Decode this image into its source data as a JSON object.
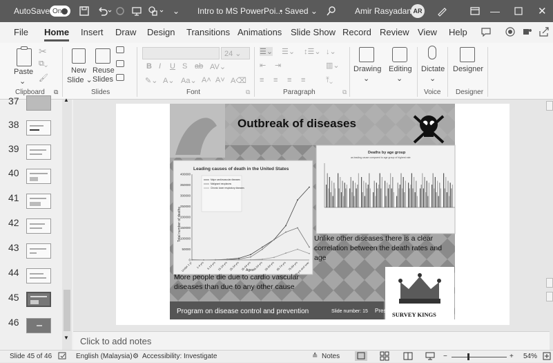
{
  "titlebar": {
    "autosave_label": "AutoSave",
    "autosave_state": "On",
    "doc_title": "Intro to MS PowerPoi...",
    "saved_status": "• Saved",
    "user_name": "Amir Rasyadan",
    "user_initials": "AR"
  },
  "menu": {
    "tabs": [
      "File",
      "Home",
      "Insert",
      "Draw",
      "Design",
      "Transitions",
      "Animations",
      "Slide Show",
      "Record",
      "Review",
      "View",
      "Help"
    ],
    "active": "Home"
  },
  "ribbon": {
    "paste": "Paste",
    "clipboard": "Clipboard",
    "new_slide_1": "New",
    "new_slide_2": "Slide",
    "reuse_1": "Reuse",
    "reuse_2": "Slides",
    "slides": "Slides",
    "font_size": "24",
    "font": "Font",
    "paragraph": "Paragraph",
    "drawing": "Drawing",
    "editing": "Editing",
    "dictate": "Dictate",
    "voice": "Voice",
    "designer_btn": "Designer",
    "designer_group": "Designer"
  },
  "thumbnails": {
    "numbers": [
      "37",
      "38",
      "39",
      "40",
      "41",
      "42",
      "43",
      "44",
      "45",
      "46"
    ],
    "selected": "45"
  },
  "slide": {
    "title": "Outbreak of diseases",
    "chart1_title": "Leading causes of death in the United States",
    "chart1_ylabel": "Total number of deaths",
    "chart1_xlabel": "Ages",
    "chart2_title": "Deaths by age group",
    "chart2_subtitle": "as leading cause compared to age group of highest rate",
    "text_right": "Unlike other diseases there is a clear correlation between the death rates and age",
    "text_left": "More people die due to cardio vascular diseases than due to any other cause",
    "footer_left": "Program on disease control and prevention",
    "footer_slide": "Slide number: 15",
    "watermark": "Presentation-Process.com",
    "logo_text": "SURVEY KINGS"
  },
  "chart_data": {
    "type": "line",
    "title": "Leading causes of death in the United States",
    "ylabel": "Total number of deaths",
    "xlabel": "Ages",
    "categories": [
      "Under 1 yr",
      "1-4 yrs",
      "5-14 yrs",
      "15-24 yrs",
      "25-34 yrs",
      "35-44 yrs",
      "45-54 yrs",
      "55-64 yrs",
      "65-74 yrs",
      "75-84 yrs",
      "85 yrs and over"
    ],
    "ylim": [
      0,
      400000
    ],
    "yticks": [
      "0",
      "50000",
      "100000",
      "150000",
      "200000",
      "250000",
      "300000",
      "350000",
      "400000"
    ],
    "series": [
      {
        "name": "Major cardiovascular diseases",
        "values": [
          1000,
          500,
          800,
          3000,
          8000,
          25000,
          60000,
          95000,
          160000,
          280000,
          340000
        ]
      },
      {
        "name": "Malignant neoplasms",
        "values": [
          100,
          300,
          1000,
          1700,
          3700,
          14000,
          50000,
          95000,
          130000,
          150000,
          60000
        ]
      },
      {
        "name": "Chronic lower respiratory diseases",
        "values": [
          0,
          0,
          0,
          200,
          300,
          1000,
          3500,
          12000,
          32000,
          50000,
          30000
        ]
      }
    ]
  },
  "notes": {
    "placeholder": "Click to add notes"
  },
  "status": {
    "slide_count": "Slide 45 of 46",
    "language": "English (Malaysia)",
    "accessibility": "Accessibility: Investigate",
    "notes_btn": "Notes",
    "zoom": "54%"
  }
}
